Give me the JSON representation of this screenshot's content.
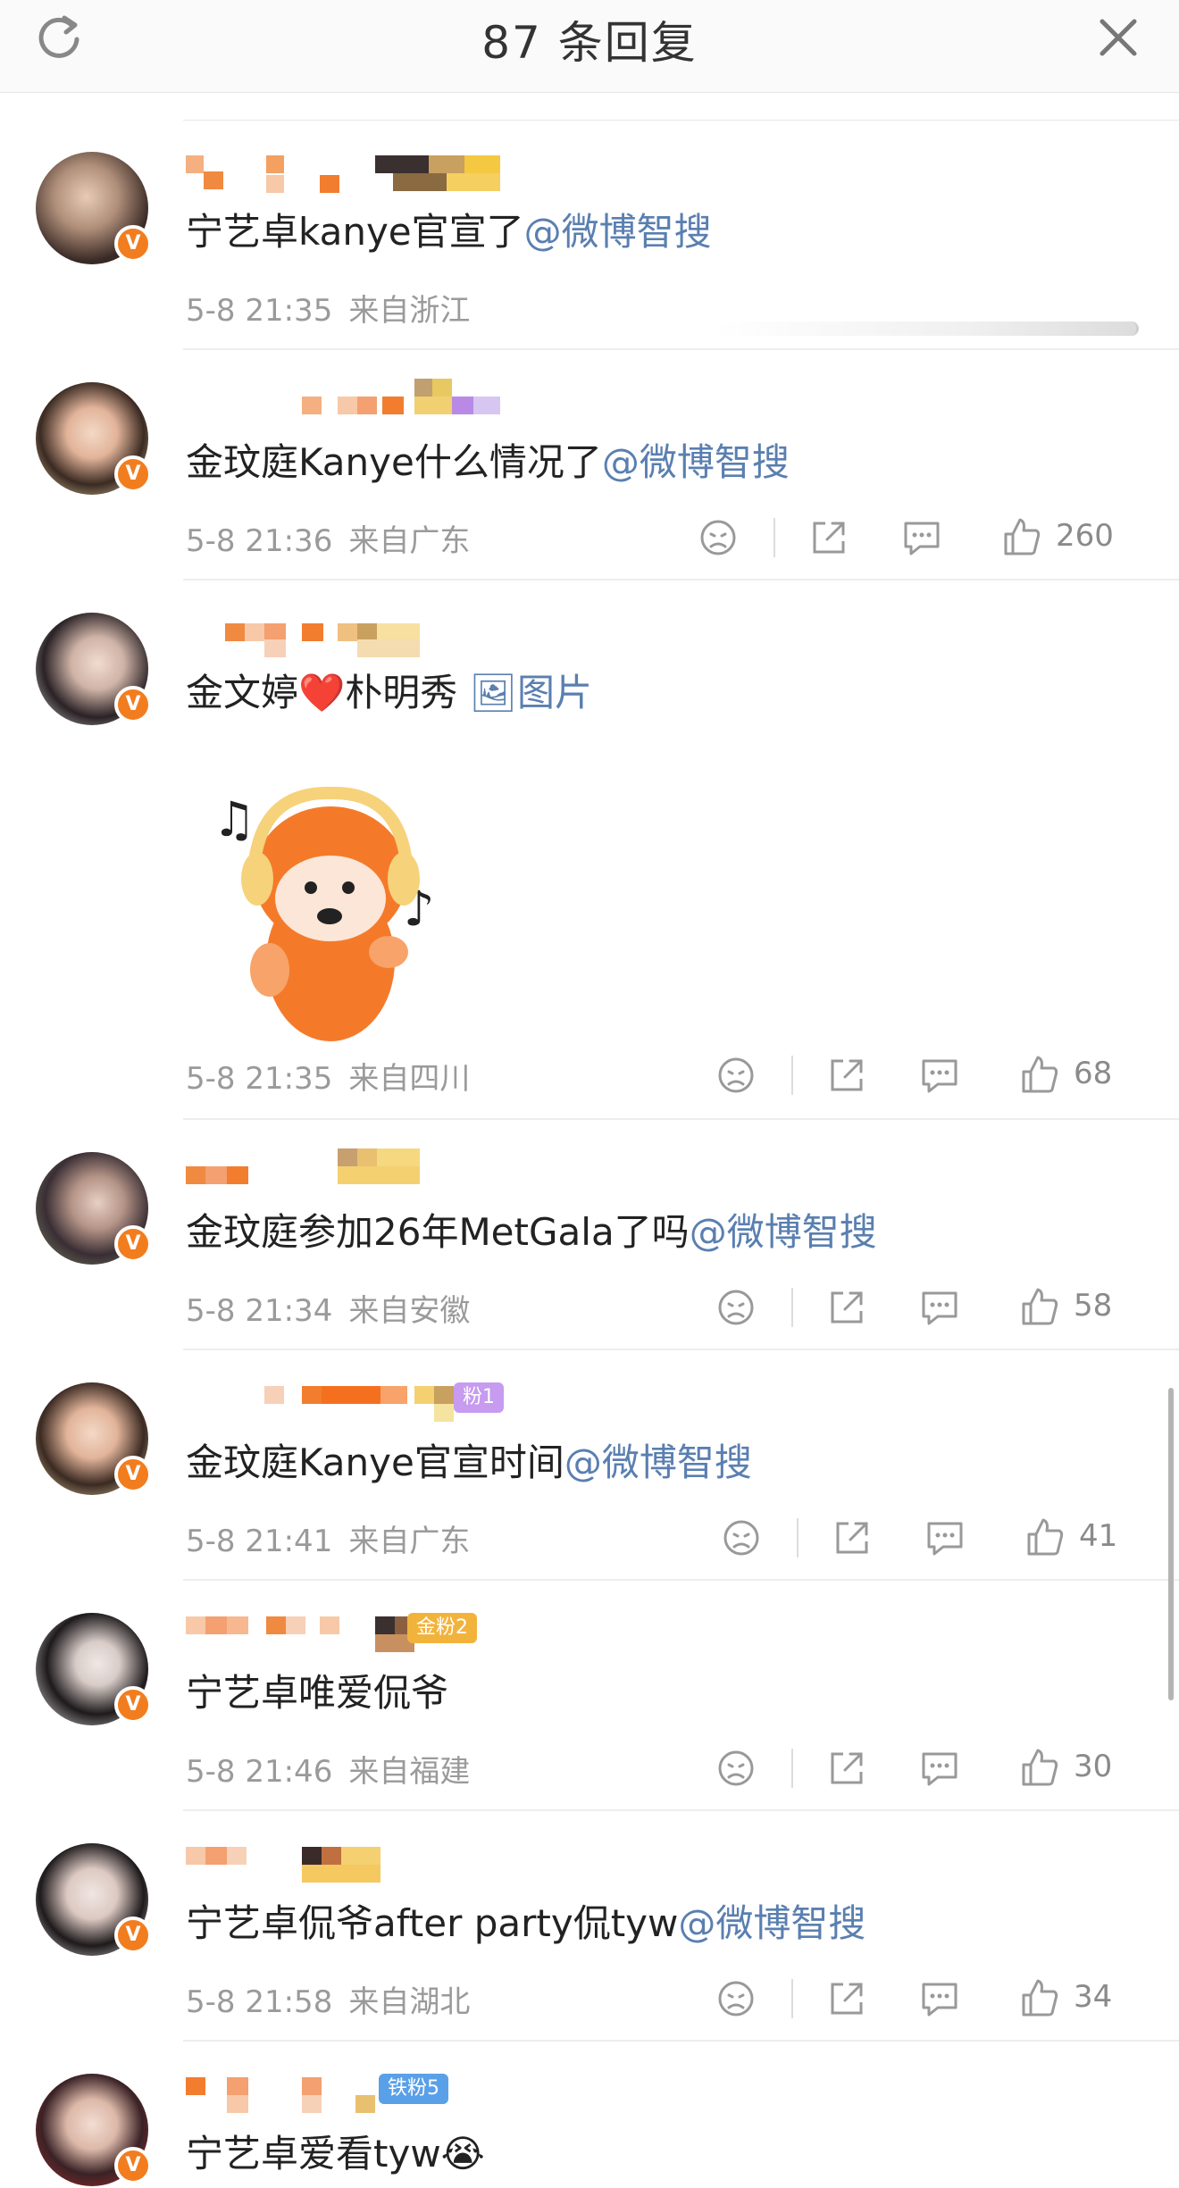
{
  "header": {
    "title": "87 条回复",
    "refresh_icon": "refresh-icon",
    "close_icon": "close-icon"
  },
  "colors": {
    "mention": "#5a7fb0",
    "vbadge": "#f27d1f",
    "meta": "#9a9a9a",
    "text": "#222222"
  },
  "comments": [
    {
      "text": "宁艺卓kanye官宣了",
      "mention": "@微博智搜",
      "time": "5-8 21:35",
      "location": "来自浙江",
      "likes": ""
    },
    {
      "text": "金玟庭Kanye什么情况了",
      "mention": "@微博智搜",
      "time": "5-8 21:36",
      "location": "来自广东",
      "likes": "260"
    },
    {
      "text": "金文婷❤️朴明秀",
      "mention": "🖼图片",
      "time": "5-8 21:35",
      "location": "来自四川",
      "likes": "68"
    },
    {
      "text": "金玟庭参加26年MetGala了吗",
      "mention": "@微博智搜",
      "time": "5-8 21:34",
      "location": "来自安徽",
      "likes": "58"
    },
    {
      "text": "金玟庭Kanye官宣时间",
      "mention": "@微博智搜",
      "time": "5-8 21:41",
      "location": "来自广东",
      "likes": "41",
      "badge": "粉1"
    },
    {
      "text": "宁艺卓唯爱侃爷",
      "mention": "",
      "time": "5-8 21:46",
      "location": "来自福建",
      "likes": "30",
      "badge": "金粉2"
    },
    {
      "text": "宁艺卓侃爷after party侃tyw",
      "mention": "@微博智搜",
      "time": "5-8 21:58",
      "location": "来自湖北",
      "likes": "34"
    },
    {
      "text": "宁艺卓爱看tyw😭",
      "mention": "",
      "badge": "铁粉5"
    }
  ]
}
